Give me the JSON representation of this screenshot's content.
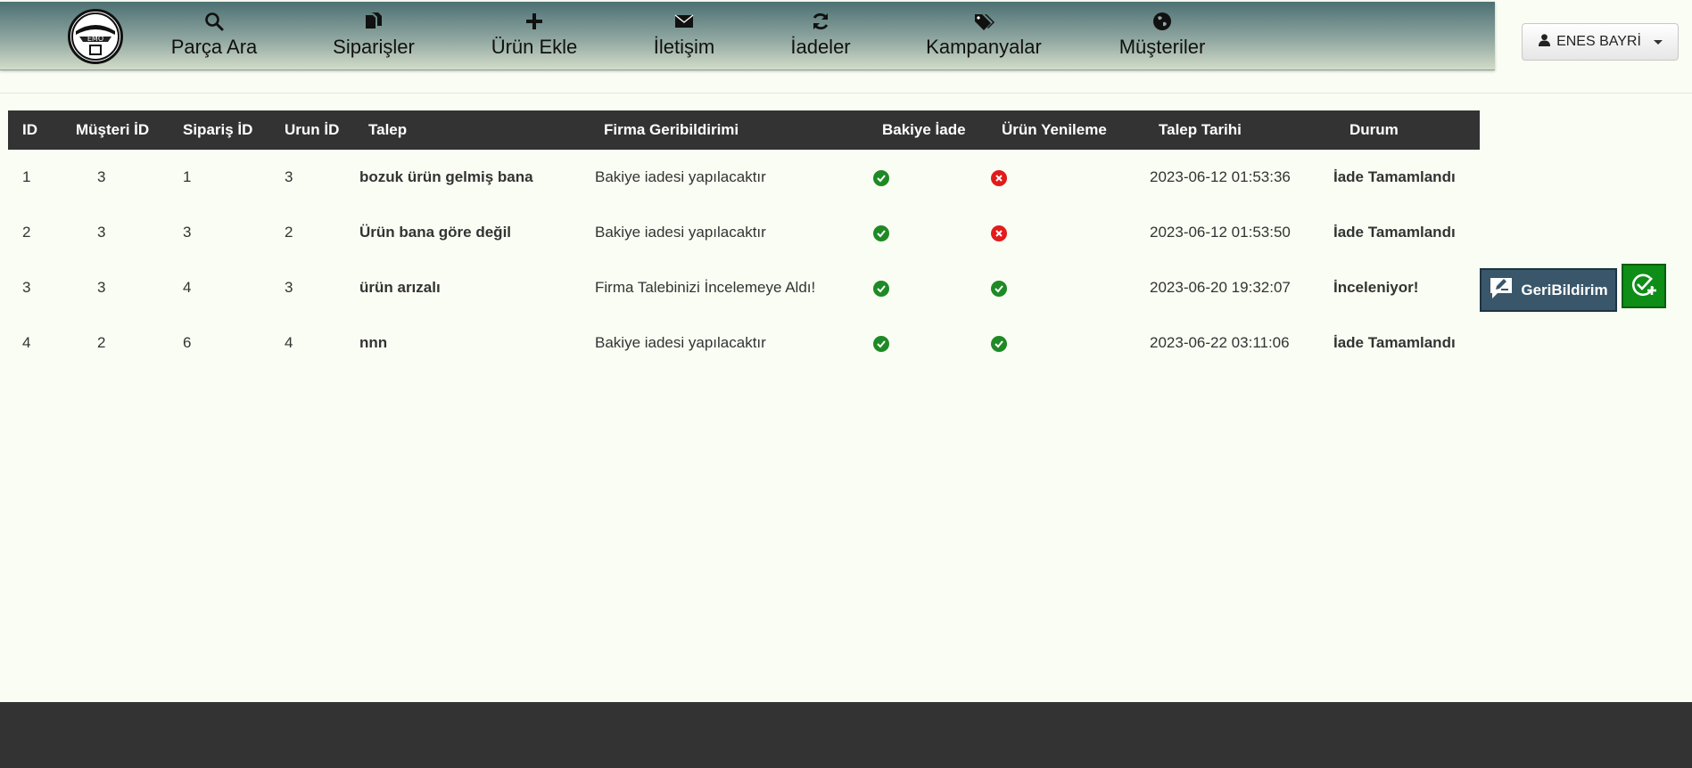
{
  "nav": {
    "items": [
      {
        "label": "Parça Ara",
        "icon": "search-icon"
      },
      {
        "label": "Siparişler",
        "icon": "documents-icon"
      },
      {
        "label": "Ürün Ekle",
        "icon": "plus-icon"
      },
      {
        "label": "İletişim",
        "icon": "envelope-icon"
      },
      {
        "label": "İadeler",
        "icon": "refresh-icon"
      },
      {
        "label": "Kampanyalar",
        "icon": "tags-icon"
      },
      {
        "label": "Müşteriler",
        "icon": "globe-icon"
      }
    ],
    "logo_text": "EMO"
  },
  "user": {
    "name": "ENES BAYRİ"
  },
  "table": {
    "headers": [
      "ID",
      "Müşteri İD",
      "Sipariş İD",
      "Urun İD",
      "Talep",
      "Firma Geribildirimi",
      "Bakiye İade",
      "Ürün Yenileme",
      "Talep Tarihi",
      "Durum"
    ],
    "rows": [
      {
        "id": "1",
        "musteri": "3",
        "siparis": "1",
        "urun": "3",
        "talep": "bozuk ürün gelmiş bana",
        "geribildirim": "Bakiye iadesi yapılacaktır",
        "bakiye": true,
        "yenileme": false,
        "tarih": "2023-06-12 01:53:36",
        "durum": "İade Tamamlandı"
      },
      {
        "id": "2",
        "musteri": "3",
        "siparis": "3",
        "urun": "2",
        "talep": "Ürün bana göre değil",
        "geribildirim": "Bakiye iadesi yapılacaktır",
        "bakiye": true,
        "yenileme": false,
        "tarih": "2023-06-12 01:53:50",
        "durum": "İade Tamamlandı"
      },
      {
        "id": "3",
        "musteri": "3",
        "siparis": "4",
        "urun": "3",
        "talep": "ürün arızalı",
        "geribildirim": "Firma Talebinizi İncelemeye Aldı!",
        "bakiye": true,
        "yenileme": true,
        "tarih": "2023-06-20 19:32:07",
        "durum": "İnceleniyor!"
      },
      {
        "id": "4",
        "musteri": "2",
        "siparis": "6",
        "urun": "4",
        "talep": "nnn",
        "geribildirim": "Bakiye iadesi yapılacaktır",
        "bakiye": true,
        "yenileme": true,
        "tarih": "2023-06-22 03:11:06",
        "durum": "İade Tamamlandı"
      }
    ]
  },
  "actions": {
    "feedback_label": "GeriBildirim"
  },
  "colors": {
    "ok": "#1e8a25",
    "no": "#e21b1b",
    "header_bg": "#333333",
    "feedback_bg": "#39566a",
    "approve_bg": "#0e8d17"
  }
}
